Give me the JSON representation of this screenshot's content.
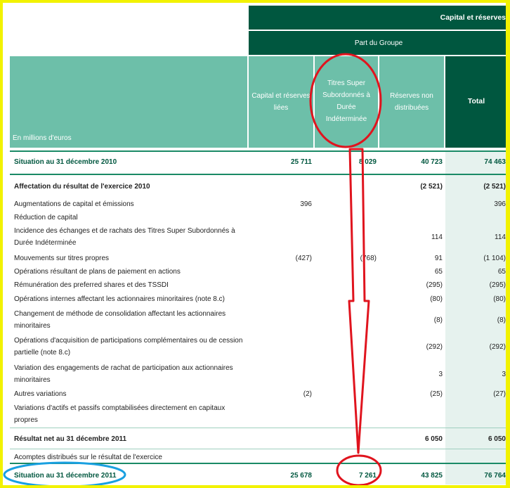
{
  "header": {
    "group_title": "Capital et réserves",
    "part_title": "Part du Groupe",
    "unit_label": "En millions d'euros",
    "columns": [
      {
        "label": "Capital et réserves liées"
      },
      {
        "label": "Titres Super Subordonnés à Durée Indéterminée"
      },
      {
        "label": "Réserves non distribuées"
      },
      {
        "label": "Total"
      }
    ]
  },
  "rows": [
    {
      "label": "Situation au 31 décembre 2010",
      "values": [
        "25 711",
        "8 029",
        "40 723",
        "74 463"
      ]
    },
    {
      "label": "Affectation du résultat de l'exercice 2010",
      "values": [
        "",
        "",
        "(2 521)",
        "(2 521)"
      ]
    },
    {
      "label": "Augmentations de capital et émissions",
      "values": [
        "396",
        "",
        "",
        "396"
      ]
    },
    {
      "label": "Réduction de capital",
      "values": [
        "",
        "",
        "",
        ""
      ]
    },
    {
      "label": "Incidence des échanges et de rachats des Titres Super Subordonnés à Durée Indéterminée",
      "values": [
        "",
        "",
        "114",
        "114"
      ]
    },
    {
      "label": "Mouvements sur titres propres",
      "values": [
        "(427)",
        "(768)",
        "91",
        "(1 104)"
      ]
    },
    {
      "label": "Opérations résultant de plans de paiement en actions",
      "values": [
        "",
        "",
        "65",
        "65"
      ]
    },
    {
      "label": "Rémunération des preferred shares et des TSSDI",
      "values": [
        "",
        "",
        "(295)",
        "(295)"
      ]
    },
    {
      "label": "Opérations internes affectant les actionnaires minoritaires (note 8.c)",
      "values": [
        "",
        "",
        "(80)",
        "(80)"
      ]
    },
    {
      "label": "Changement de méthode de consolidation affectant les actionnaires minoritaires",
      "values": [
        "",
        "",
        "(8)",
        "(8)"
      ]
    },
    {
      "label": "Opérations d'acquisition de participations complémentaires ou de cession partielle (note 8.c)",
      "values": [
        "",
        "",
        "(292)",
        "(292)"
      ]
    },
    {
      "label": "Variation des engagements de rachat de participation aux actionnaires minoritaires",
      "values": [
        "",
        "",
        "3",
        "3"
      ]
    },
    {
      "label": "Autres variations",
      "values": [
        "(2)",
        "",
        "(25)",
        "(27)"
      ]
    },
    {
      "label": "Variations d'actifs et passifs comptabilisées directement en capitaux propres",
      "values": [
        "",
        "",
        "",
        ""
      ]
    },
    {
      "label": "Résultat net au 31 décembre 2011",
      "values": [
        "",
        "",
        "6 050",
        "6 050"
      ]
    },
    {
      "label": "Acomptes distribués sur le résultat de l'exercice",
      "values": [
        "",
        "",
        "",
        ""
      ]
    },
    {
      "label": "Situation au 31 décembre 2011",
      "values": [
        "25 678",
        "7 261",
        "43 825",
        "76 764"
      ]
    }
  ],
  "colors": {
    "dark_green": "#00573f",
    "light_green": "#6dbfa9",
    "frame_yellow": "#f2f200",
    "annotation_red": "#e0141e",
    "annotation_blue": "#1aa0e0"
  }
}
